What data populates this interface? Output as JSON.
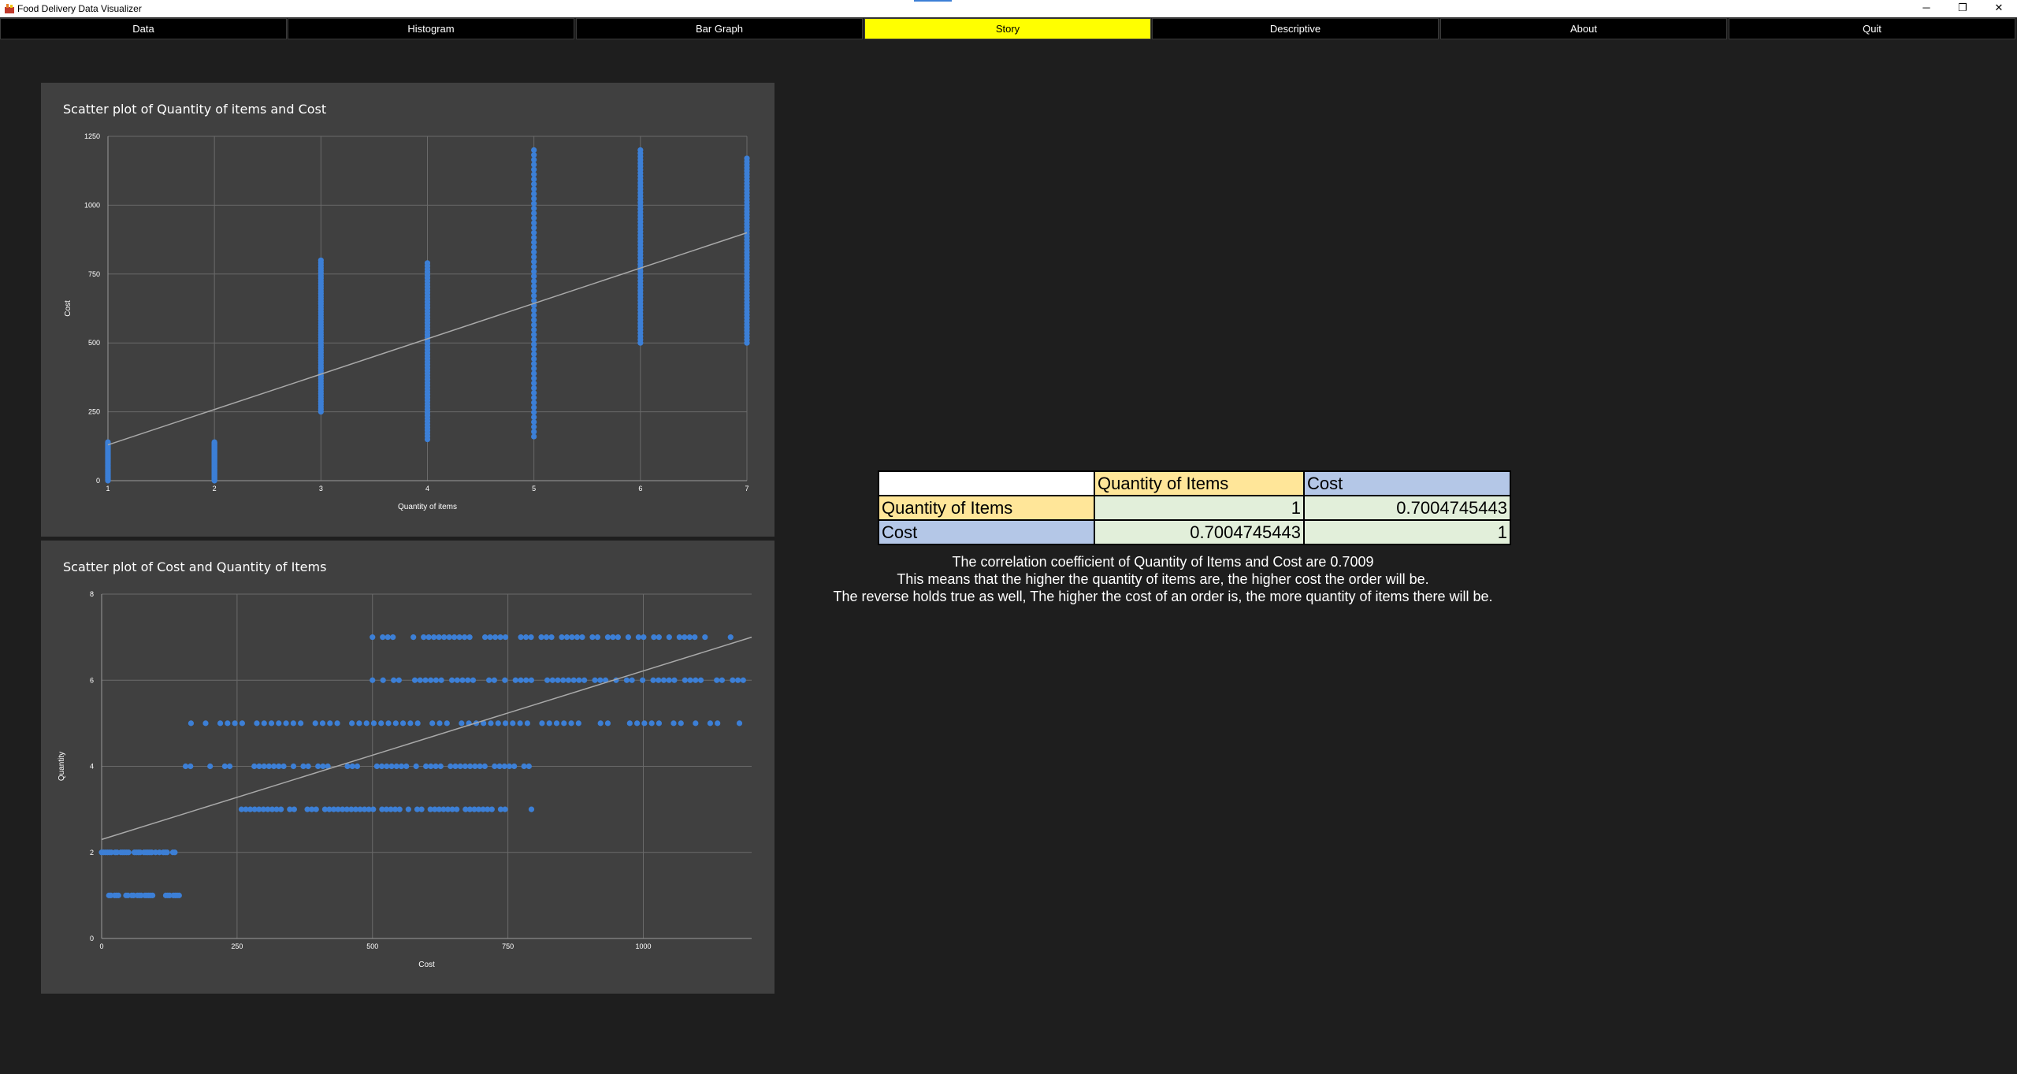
{
  "window": {
    "title": "Food Delivery Data Visualizer",
    "controls": {
      "minimize": "─",
      "restore": "❐",
      "close": "✕"
    }
  },
  "nav": {
    "tabs": [
      {
        "label": "Data",
        "active": false
      },
      {
        "label": "Histogram",
        "active": false
      },
      {
        "label": "Bar Graph",
        "active": false
      },
      {
        "label": "Story",
        "active": true
      },
      {
        "label": "Descriptive",
        "active": false
      },
      {
        "label": "About",
        "active": false
      },
      {
        "label": "Quit",
        "active": false
      }
    ]
  },
  "colors": {
    "active_tab": "#ffff00",
    "point": "#3c7fd6",
    "trend": "#a9a9a9",
    "panel": "#404040"
  },
  "chart_data": [
    {
      "type": "scatter",
      "title": "Scatter plot of Quantity of items and Cost",
      "xlabel": "Quantity of items",
      "ylabel": "Cost",
      "xlim": [
        1,
        7
      ],
      "ylim": [
        0,
        1250
      ],
      "x_ticks": [
        "1",
        "2",
        "3",
        "4",
        "5",
        "6",
        "7"
      ],
      "y_ticks": [
        "0",
        "250",
        "500",
        "750",
        "1000",
        "1250"
      ],
      "grid": true,
      "trendline": {
        "x": [
          1,
          7
        ],
        "y": [
          130,
          900
        ]
      },
      "columns": [
        {
          "x": 1,
          "y_range": [
            0,
            140
          ]
        },
        {
          "x": 2,
          "y_range": [
            0,
            140
          ]
        },
        {
          "x": 3,
          "y_range": [
            250,
            800
          ]
        },
        {
          "x": 4,
          "y_range": [
            150,
            790
          ]
        },
        {
          "x": 5,
          "y_range": [
            160,
            1200
          ]
        },
        {
          "x": 6,
          "y_range": [
            500,
            1200
          ]
        },
        {
          "x": 7,
          "y_range": [
            500,
            1170
          ]
        }
      ]
    },
    {
      "type": "scatter",
      "title": "Scatter plot of Cost and Quantity of Items",
      "xlabel": "Cost",
      "ylabel": "Quantity",
      "xlim": [
        0,
        1200
      ],
      "ylim": [
        0,
        8
      ],
      "x_ticks": [
        "0",
        "250",
        "500",
        "750",
        "1000"
      ],
      "y_ticks": [
        "0",
        "2",
        "4",
        "6",
        "8"
      ],
      "grid": true,
      "trendline": {
        "x": [
          0,
          1200
        ],
        "y": [
          2.3,
          7.0
        ]
      },
      "rows": [
        {
          "y": 1,
          "x_range": [
            10,
            145
          ]
        },
        {
          "y": 2,
          "x_range": [
            0,
            140
          ]
        },
        {
          "y": 3,
          "x_range": [
            250,
            800
          ]
        },
        {
          "y": 4,
          "x_range": [
            155,
            790
          ]
        },
        {
          "y": 5,
          "x_range": [
            165,
            1200
          ]
        },
        {
          "y": 6,
          "x_range": [
            500,
            1200
          ]
        },
        {
          "y": 7,
          "x_range": [
            500,
            1170
          ]
        }
      ]
    }
  ],
  "correlation": {
    "headers": [
      "",
      "Quantity of Items",
      "Cost"
    ],
    "rows": [
      {
        "label": "Quantity of Items",
        "v1": "1",
        "v2": "0.7004745443"
      },
      {
        "label": "Cost",
        "v1": "0.7004745443",
        "v2": "1"
      }
    ]
  },
  "story": {
    "line1": "The correlation coefficient of Quantity of Items and Cost are 0.7009",
    "line2": "This means that the higher the quantity of items are, the higher cost the order will be.",
    "line3": "The reverse holds true as well, The higher the cost of an order is, the more quantity of items there will be."
  }
}
